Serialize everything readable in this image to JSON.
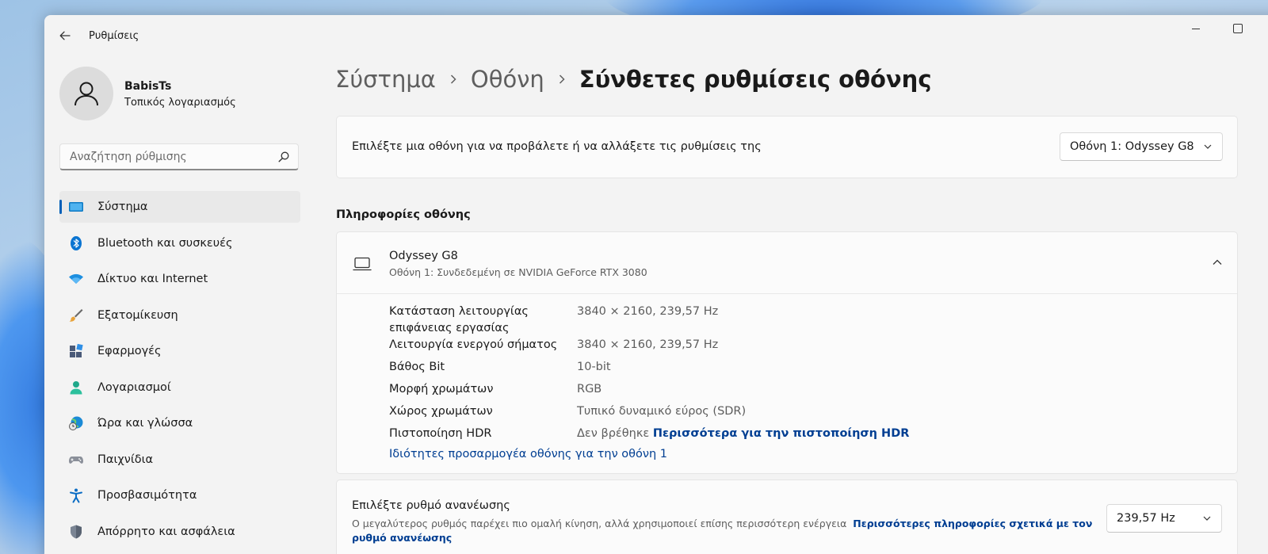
{
  "window": {
    "app_title": "Ρυθμίσεις"
  },
  "profile": {
    "name": "BabisTs",
    "account_type": "Τοπικός λογαριασμός"
  },
  "search": {
    "placeholder": "Αναζήτηση ρύθμισης"
  },
  "sidebar": {
    "items": [
      {
        "label": "Σύστημα",
        "icon": "system-icon",
        "active": true
      },
      {
        "label": "Bluetooth και συσκευές",
        "icon": "bluetooth-icon"
      },
      {
        "label": "Δίκτυο και Internet",
        "icon": "wifi-icon"
      },
      {
        "label": "Εξατομίκευση",
        "icon": "brush-icon"
      },
      {
        "label": "Εφαρμογές",
        "icon": "apps-icon"
      },
      {
        "label": "Λογαριασμοί",
        "icon": "account-icon"
      },
      {
        "label": "Ώρα και γλώσσα",
        "icon": "globe-clock-icon"
      },
      {
        "label": "Παιχνίδια",
        "icon": "gamepad-icon"
      },
      {
        "label": "Προσβασιμότητα",
        "icon": "accessibility-icon"
      },
      {
        "label": "Απόρρητο και ασφάλεια",
        "icon": "shield-icon"
      }
    ]
  },
  "breadcrumb": {
    "items": [
      "Σύστημα",
      "Οθόνη"
    ],
    "current": "Σύνθετες ρυθμίσεις οθόνης"
  },
  "display_select": {
    "label": "Επιλέξτε μια οθόνη για να προβάλετε ή να αλλάξετε τις ρυθμίσεις της",
    "selected": "Οθόνη 1: Odyssey G8"
  },
  "display_info": {
    "section_title": "Πληροφορίες οθόνης",
    "monitor_name": "Odyssey G8",
    "monitor_sub": "Οθόνη 1: Συνδεδεμένη σε NVIDIA GeForce RTX 3080",
    "rows": [
      {
        "label": "Κατάσταση λειτουργίας επιφάνειας εργασίας",
        "value": "3840 × 2160, 239,57 Hz"
      },
      {
        "label": "Λειτουργία ενεργού σήματος",
        "value": "3840 × 2160, 239,57 Hz"
      },
      {
        "label": "Βάθος Bit",
        "value": "10-bit"
      },
      {
        "label": "Μορφή χρωμάτων",
        "value": "RGB"
      },
      {
        "label": "Χώρος χρωμάτων",
        "value": "Τυπικό δυναμικό εύρος (SDR)"
      },
      {
        "label": "Πιστοποίηση HDR",
        "value": "Δεν βρέθηκε",
        "link": "Περισσότερα για την πιστοποίηση HDR"
      }
    ],
    "adapter_link": "Ιδιότητες προσαρμογέα οθόνης για την οθόνη 1"
  },
  "refresh_rate": {
    "title": "Επιλέξτε ρυθμό ανανέωσης",
    "description": "Ο μεγαλύτερος ρυθμός παρέχει πιο ομαλή κίνηση, αλλά χρησιμοποιεί επίσης περισσότερη ενέργεια",
    "link": "Περισσότερες πληροφορίες σχετικά με τον ρυθμό ανανέωσης",
    "selected": "239,57 Hz"
  }
}
